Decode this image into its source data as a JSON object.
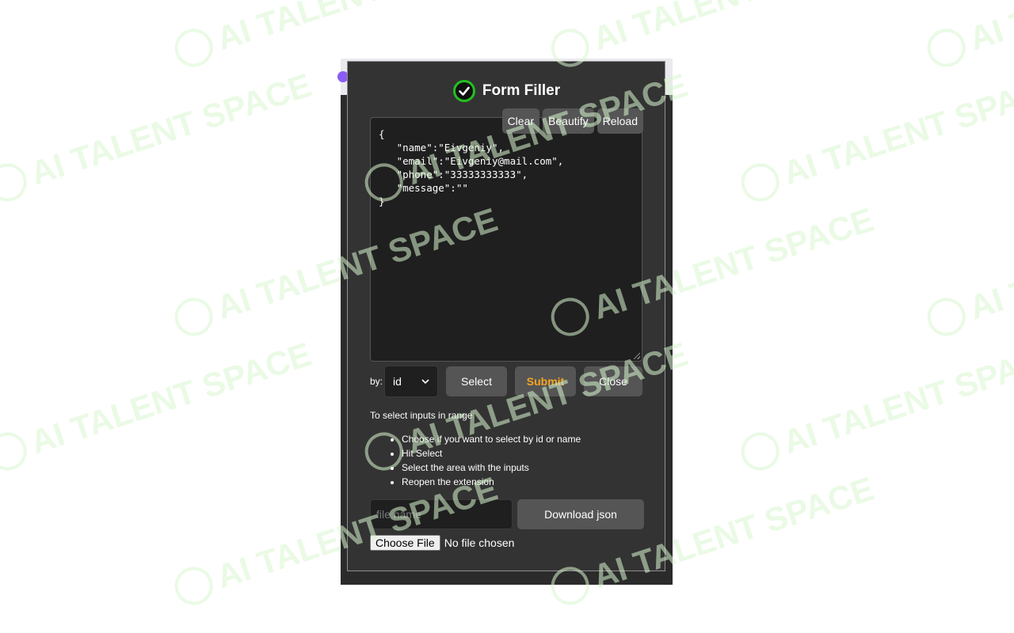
{
  "header": {
    "title": "Form Filler"
  },
  "editor": {
    "buttons": [
      "Clear",
      "Beautify",
      "Reload"
    ],
    "content": "{\n   \"name\":\"Eivgeniy\",\n   \"email\":\"Eivgeniy@mail.com\",\n   \"phone\":\"33333333333\",\n   \"message\":\"\"\n}"
  },
  "controls": {
    "by_label": "by:",
    "select_value": "id",
    "select_button": "Select",
    "submit_button": "Submit",
    "close_button": "Close"
  },
  "instructions": {
    "heading": "To select inputs in range",
    "steps": [
      "Choose if you want to select by id or name",
      "Hit Select",
      "Select the area with the inputs",
      "Reopen the extension"
    ]
  },
  "file": {
    "placeholder": "file name",
    "download_button": "Download json",
    "choose_button": "Choose File",
    "status": "No file chosen"
  },
  "watermark": {
    "text": "AI TALENT SPACE"
  },
  "colors": {
    "accent_green": "#22c11f",
    "submit_orange": "#f5a623",
    "popup_bg": "#333333",
    "button_bg": "#555555",
    "watermark": "#d9f7d0"
  }
}
